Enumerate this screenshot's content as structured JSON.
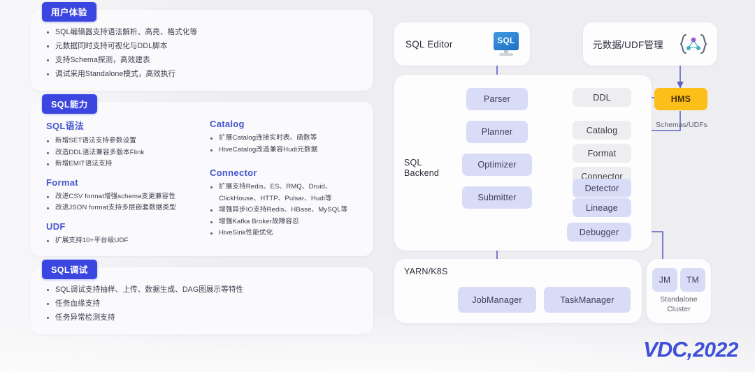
{
  "theme": {
    "background": "#eeeef2",
    "badge_blue": "#3b46e0",
    "heading_blue": "#4554cf",
    "node_blue": "#d9dcf7",
    "node_grey": "#eeeef0",
    "node_gold": "#fcbf19",
    "wire": "#5b62c4"
  },
  "left": {
    "sections": [
      {
        "badge": "用户体验",
        "bullets": [
          "SQL编辑器支持语法解析、高亮、格式化等",
          "元数据同时支持可视化与DDL脚本",
          "支持Schema探测，高效建表",
          "调试采用Standalone模式，高效执行"
        ]
      },
      {
        "badge": "SQL能力",
        "groups_left": [
          {
            "title": "SQL语法",
            "bullets": [
              "新增SET语法支持参数设置",
              "改造DDL语法兼容多版本Flink",
              "新增EMIT语法支持"
            ]
          },
          {
            "title": "Format",
            "bullets": [
              "改进CSV format增强schema变更兼容性",
              "改进JSON format支持多层嵌套数据类型"
            ]
          },
          {
            "title": "UDF",
            "bullets": [
              "扩展支持10+平台级UDF"
            ]
          }
        ],
        "groups_right": [
          {
            "title": "Catalog",
            "bullets": [
              "扩展Catalog连接实时表、函数等",
              "HiveCatalog改造兼容Hudi元数据"
            ]
          },
          {
            "title": "Connector",
            "bullets": [
              "扩展支持Redis、ES、RMQ、Druid、ClickHouse、HTTP、Pulsar、Hudi等",
              "增强异步IO支持Redis、HBase、MySQL等",
              "增强Kafka Broker故障容忍",
              "HiveSink性能优化"
            ]
          }
        ]
      },
      {
        "badge": "SQL调试",
        "bullets": [
          "SQL调试支持抽样、上传、数据生成、DAG图展示等特性",
          "任务血缘支持",
          "任务异常检测支持"
        ]
      }
    ]
  },
  "diagram": {
    "top_cards": [
      {
        "label": "SQL Editor",
        "icon": "sql-monitor-icon",
        "icon_text": "SQL"
      },
      {
        "label": "元数据/UDF管理",
        "icon": "udf-graph-icon"
      }
    ],
    "backend_panel_title": "SQL\nBackend",
    "backend_title_line1": "SQL",
    "backend_title_line2": "Backend",
    "pipeline": [
      {
        "name": "Parser"
      },
      {
        "name": "Planner"
      },
      {
        "name": "Optimizer"
      },
      {
        "name": "Submitter"
      }
    ],
    "grey_nodes": [
      {
        "name": "DDL"
      },
      {
        "name": "Catalog"
      },
      {
        "name": "Format"
      },
      {
        "name": "Connector"
      }
    ],
    "blue_right_nodes": [
      {
        "name": "Detector"
      },
      {
        "name": "Lineage"
      },
      {
        "name": "Debugger"
      }
    ],
    "hms": {
      "label": "HMS",
      "caption": "Schemas/UDFs"
    },
    "yarn_panel": {
      "title": "YARN/K8S",
      "nodes": [
        {
          "name": "JobManager"
        },
        {
          "name": "TaskManager"
        }
      ]
    },
    "standalone_panel": {
      "nodes": [
        {
          "name": "JM"
        },
        {
          "name": "TM"
        }
      ],
      "caption_line1": "Standalone",
      "caption_line2": "Cluster"
    }
  },
  "logo": {
    "mark": "VDC,",
    "year": "2022"
  }
}
